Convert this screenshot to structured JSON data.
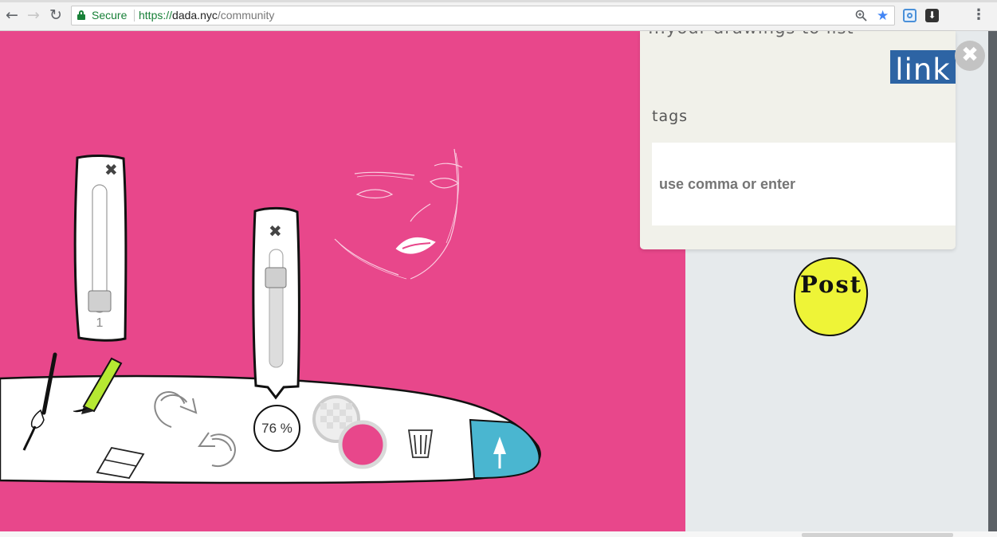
{
  "browser": {
    "secure_label": "Secure",
    "url_scheme": "https://",
    "url_host": "dada.nyc",
    "url_path": "/community",
    "icons": [
      "back-icon",
      "forward-icon",
      "reload-icon",
      "lock-icon",
      "zoom-icon",
      "bookmark-star-icon",
      "extension-icon",
      "pocket-icon",
      "menu-icon"
    ]
  },
  "panel": {
    "cut_text": "...your drawings to list",
    "link_label": "link",
    "tags_label": "tags",
    "tags_placeholder": "use comma or enter",
    "close_icon": "close-icon"
  },
  "post_button": {
    "label": "Post",
    "color": "#eef437"
  },
  "toolbar": {
    "brush_size_value": "1",
    "opacity_value": "76 %",
    "primary_color": "#e8478b",
    "secondary_color": "transparent",
    "tools": [
      "brush-icon",
      "marker-icon",
      "eraser-icon",
      "redo-icon",
      "undo-icon",
      "trash-icon",
      "upload-arrow-icon"
    ],
    "upload_color": "#4ab6d0"
  },
  "canvas": {
    "background": "#e8478b",
    "drawing": "face sketch"
  }
}
